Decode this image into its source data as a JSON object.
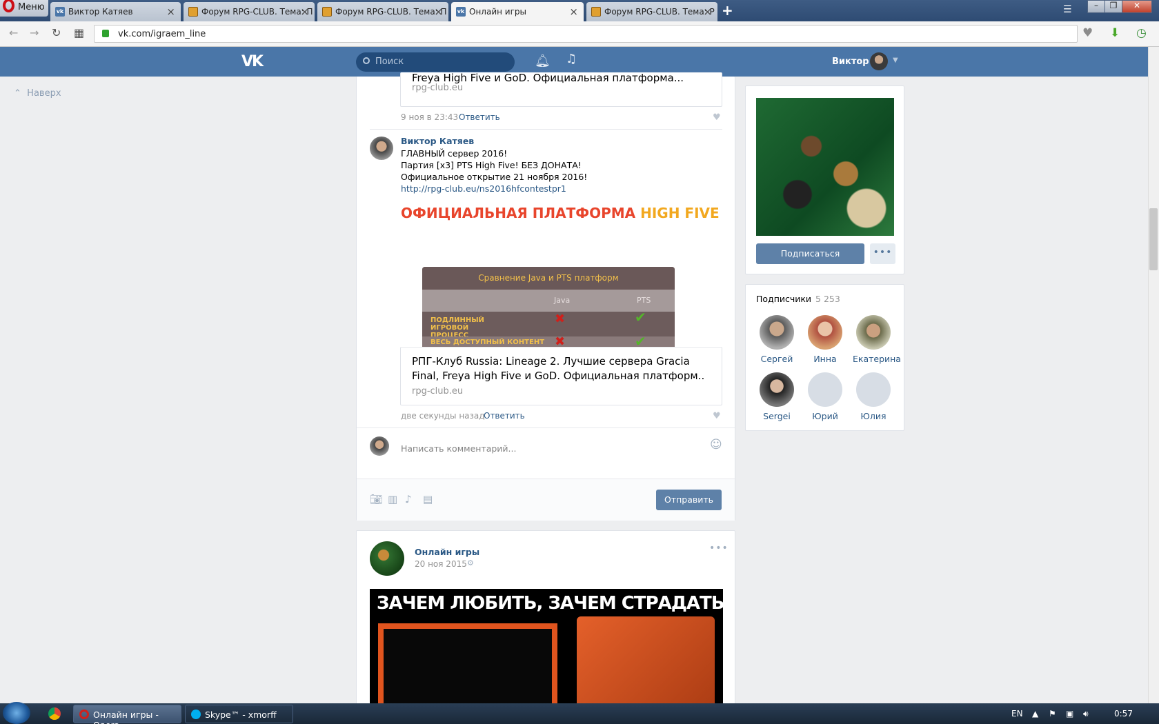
{
  "browser": {
    "menu_label": "Меню",
    "tabs": [
      {
        "label": "Виктор Катяев",
        "icon": "vk"
      },
      {
        "label": "Форум RPG-CLUB. Тема: П",
        "icon": "rpg"
      },
      {
        "label": "Форум RPG-CLUB. Тема: П",
        "icon": "rpg"
      },
      {
        "label": "Онлайн игры",
        "icon": "vk",
        "active": true
      },
      {
        "label": "Форум RPG-CLUB. Тема: Р",
        "icon": "rpg"
      }
    ],
    "new_tab": "+",
    "url": "vk.com/igraem_line"
  },
  "vk_header": {
    "logo": "VK",
    "search_placeholder": "Поиск",
    "user_name": "Виктор"
  },
  "left": {
    "scroll_up": "Наверх"
  },
  "post_top": {
    "link_title_tail": "Freya High Five и GoD. Официальная платформа...",
    "link_domain": "rpg-club.eu",
    "time": "9 ноя в 23:43",
    "reply": "Ответить"
  },
  "comment": {
    "author": "Виктор Катяев",
    "lines": [
      "ГЛАВНЫЙ сервер 2016!",
      "Партия [x3] PTS High Five! БЕЗ ДОНАТА!",
      "Официальное открытие 21 ноября 2016!"
    ],
    "link": "http://rpg-club.eu/ns2016hfcontestpr1",
    "preview": {
      "title_part1": "ОФИЦИАЛЬНАЯ ПЛАТФОРМА",
      "title_part2": "HIGH FIVE",
      "table_title": "Сравнение Java и PTS платформ",
      "col1": "Java",
      "col2": "PTS",
      "row1": "ПОДЛИННЫЙ ИГРОВОЙ ПРОЦЕСС",
      "row2": "ВЕСЬ ДОСТУПНЫЙ КОНТЕНТ"
    },
    "link_title": "РПГ-Клуб Russia: Lineage 2. Лучшие сервера Gracia Final, Freya High Five и GoD. Официальная платформ..",
    "link_domain": "rpg-club.eu",
    "time": "две секунды назад",
    "reply": "Ответить"
  },
  "comment_box": {
    "placeholder": "Написать комментарий...",
    "send": "Отправить"
  },
  "post2": {
    "author": "Онлайн игры",
    "date": "20 ноя 2015",
    "image_caption": "ЗАЧЕМ ЛЮБИТЬ, ЗАЧЕМ СТРАДАТЬ"
  },
  "group": {
    "subscribe": "Подписаться"
  },
  "subscribers": {
    "title": "Подписчики",
    "count": "5 253",
    "people": [
      "Сергей",
      "Инна",
      "Екатерина",
      "Sergei",
      "Юрий",
      "Юлия"
    ]
  },
  "taskbar": {
    "opera": "Онлайн игры - Opera",
    "skype": "Skype™ - xmorff",
    "lang": "EN",
    "clock": "0:57"
  },
  "colors": {
    "vk_blue": "#4a76a8",
    "link": "#2a5885",
    "button": "#5e81a8"
  }
}
